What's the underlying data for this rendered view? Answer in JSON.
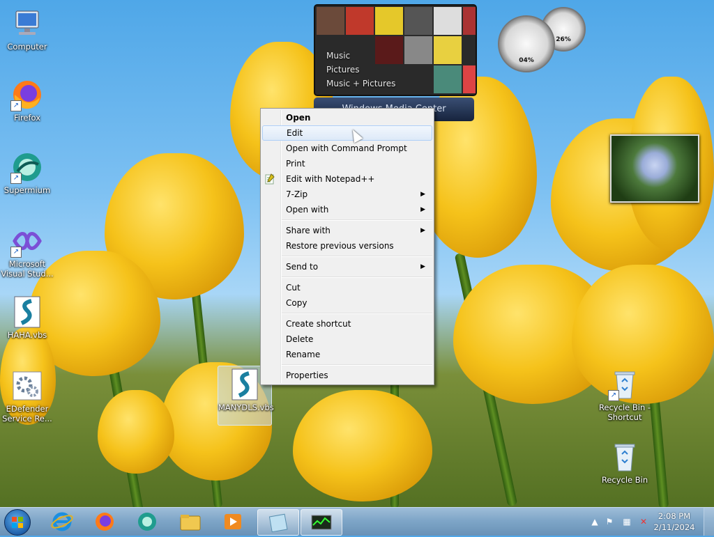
{
  "desktop": {
    "icons": [
      {
        "label": "Computer",
        "icon": "computer-icon"
      },
      {
        "label": "Firefox",
        "icon": "firefox-icon"
      },
      {
        "label": "Supermium",
        "icon": "supermium-icon"
      },
      {
        "label": "Microsoft Visual Stud...",
        "icon": "visual-studio-icon"
      },
      {
        "label": "HAHA.vbs",
        "icon": "vbs-script-icon"
      },
      {
        "label": "EDefender Service Re...",
        "icon": "settings-gears-icon"
      },
      {
        "label": "MANYDLS.vbs",
        "icon": "vbs-script-icon"
      },
      {
        "label": "Recycle Bin - Shortcut",
        "icon": "recycle-bin-icon"
      },
      {
        "label": "Recycle Bin",
        "icon": "recycle-bin-icon"
      }
    ]
  },
  "gadgets": {
    "media_center": {
      "items": [
        "Music",
        "Pictures",
        "Music + Pictures"
      ],
      "bar_title": "Windows Media Center"
    },
    "cpu_meter": {
      "cpu": "04%",
      "memory": "26%"
    }
  },
  "context_menu": {
    "items": [
      {
        "label": "Open",
        "bold": true
      },
      {
        "label": "Edit",
        "hover": true
      },
      {
        "label": "Open with Command Prompt"
      },
      {
        "label": "Print"
      },
      {
        "label": "Edit with Notepad++",
        "icon": "notepadpp-icon"
      },
      {
        "label": "7-Zip",
        "submenu": true
      },
      {
        "label": "Open with",
        "submenu": true
      },
      {
        "label": "Share with",
        "submenu": true
      },
      {
        "label": "Restore previous versions"
      },
      {
        "label": "Send to",
        "submenu": true
      },
      {
        "label": "Cut"
      },
      {
        "label": "Copy"
      },
      {
        "label": "Create shortcut"
      },
      {
        "label": "Delete"
      },
      {
        "label": "Rename"
      },
      {
        "label": "Properties"
      }
    ]
  },
  "taskbar": {
    "pinned": [
      "internet-explorer-icon",
      "firefox-icon",
      "supermium-icon",
      "file-explorer-icon",
      "media-player-icon",
      "notepad-icon",
      "task-manager-icon"
    ],
    "clock": {
      "time": "2:08 PM",
      "date": "2/11/2024"
    }
  },
  "colors": {
    "menu_bg": "#f0f0f0",
    "menu_hover": "#dde9f8",
    "taskbar": "#7fa6c8"
  }
}
